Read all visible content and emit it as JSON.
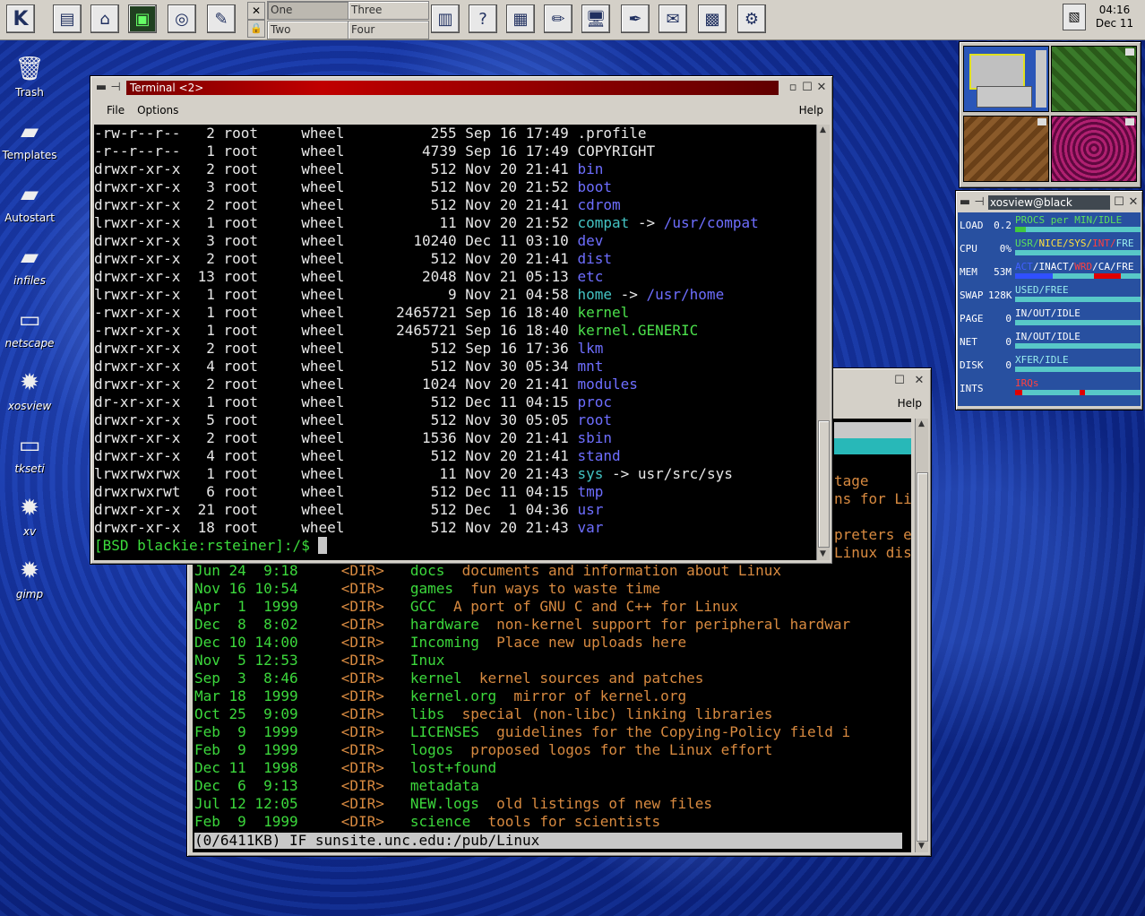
{
  "taskbar": {
    "pager": [
      "One",
      "Three",
      "Two",
      "Four"
    ],
    "clock_time": "04:16",
    "clock_date": "Dec 11"
  },
  "desktop_icons": [
    {
      "label": "Trash",
      "icon": "trash-icon"
    },
    {
      "label": "Templates",
      "icon": "folder-icon"
    },
    {
      "label": "Autostart",
      "icon": "folder-icon"
    },
    {
      "label": "infiles",
      "icon": "folder-icon"
    },
    {
      "label": "netscape",
      "icon": "monitor-icon"
    },
    {
      "label": "xosview",
      "icon": "gear-icon"
    },
    {
      "label": "tkseti",
      "icon": "monitor-icon"
    },
    {
      "label": "xv",
      "icon": "gear-icon"
    },
    {
      "label": "gimp",
      "icon": "gear-icon"
    }
  ],
  "terminal": {
    "title": "Terminal <2>",
    "menu": {
      "file": "File",
      "options": "Options",
      "help": "Help"
    },
    "rows": [
      {
        "perm": "-rw-r--r--",
        "links": "2",
        "owner": "root",
        "group": "wheel",
        "size": "255",
        "mon": "Sep",
        "day": "16",
        "time": "17:49",
        "name": ".profile",
        "color": "white",
        "link": ""
      },
      {
        "perm": "-r--r--r--",
        "links": "1",
        "owner": "root",
        "group": "wheel",
        "size": "4739",
        "mon": "Sep",
        "day": "16",
        "time": "17:49",
        "name": "COPYRIGHT",
        "color": "white",
        "link": ""
      },
      {
        "perm": "drwxr-xr-x",
        "links": "2",
        "owner": "root",
        "group": "wheel",
        "size": "512",
        "mon": "Nov",
        "day": "20",
        "time": "21:41",
        "name": "bin",
        "color": "blue",
        "link": ""
      },
      {
        "perm": "drwxr-xr-x",
        "links": "3",
        "owner": "root",
        "group": "wheel",
        "size": "512",
        "mon": "Nov",
        "day": "20",
        "time": "21:52",
        "name": "boot",
        "color": "blue",
        "link": ""
      },
      {
        "perm": "drwxr-xr-x",
        "links": "2",
        "owner": "root",
        "group": "wheel",
        "size": "512",
        "mon": "Nov",
        "day": "20",
        "time": "21:41",
        "name": "cdrom",
        "color": "blue",
        "link": ""
      },
      {
        "perm": "lrwxr-xr-x",
        "links": "1",
        "owner": "root",
        "group": "wheel",
        "size": "11",
        "mon": "Nov",
        "day": "20",
        "time": "21:52",
        "name": "compat",
        "color": "cyan",
        "link": "/usr/compat"
      },
      {
        "perm": "drwxr-xr-x",
        "links": "3",
        "owner": "root",
        "group": "wheel",
        "size": "10240",
        "mon": "Dec",
        "day": "11",
        "time": "03:10",
        "name": "dev",
        "color": "blue",
        "link": ""
      },
      {
        "perm": "drwxr-xr-x",
        "links": "2",
        "owner": "root",
        "group": "wheel",
        "size": "512",
        "mon": "Nov",
        "day": "20",
        "time": "21:41",
        "name": "dist",
        "color": "blue",
        "link": ""
      },
      {
        "perm": "drwxr-xr-x",
        "links": "13",
        "owner": "root",
        "group": "wheel",
        "size": "2048",
        "mon": "Nov",
        "day": "21",
        "time": "05:13",
        "name": "etc",
        "color": "blue",
        "link": ""
      },
      {
        "perm": "lrwxr-xr-x",
        "links": "1",
        "owner": "root",
        "group": "wheel",
        "size": "9",
        "mon": "Nov",
        "day": "21",
        "time": "04:58",
        "name": "home",
        "color": "cyan",
        "link": "/usr/home"
      },
      {
        "perm": "-rwxr-xr-x",
        "links": "1",
        "owner": "root",
        "group": "wheel",
        "size": "2465721",
        "mon": "Sep",
        "day": "16",
        "time": "18:40",
        "name": "kernel",
        "color": "green",
        "link": ""
      },
      {
        "perm": "-rwxr-xr-x",
        "links": "1",
        "owner": "root",
        "group": "wheel",
        "size": "2465721",
        "mon": "Sep",
        "day": "16",
        "time": "18:40",
        "name": "kernel.GENERIC",
        "color": "green",
        "link": ""
      },
      {
        "perm": "drwxr-xr-x",
        "links": "2",
        "owner": "root",
        "group": "wheel",
        "size": "512",
        "mon": "Sep",
        "day": "16",
        "time": "17:36",
        "name": "lkm",
        "color": "blue",
        "link": ""
      },
      {
        "perm": "drwxr-xr-x",
        "links": "4",
        "owner": "root",
        "group": "wheel",
        "size": "512",
        "mon": "Nov",
        "day": "30",
        "time": "05:34",
        "name": "mnt",
        "color": "blue",
        "link": ""
      },
      {
        "perm": "drwxr-xr-x",
        "links": "2",
        "owner": "root",
        "group": "wheel",
        "size": "1024",
        "mon": "Nov",
        "day": "20",
        "time": "21:41",
        "name": "modules",
        "color": "blue",
        "link": ""
      },
      {
        "perm": "dr-xr-xr-x",
        "links": "1",
        "owner": "root",
        "group": "wheel",
        "size": "512",
        "mon": "Dec",
        "day": "11",
        "time": "04:15",
        "name": "proc",
        "color": "blue",
        "link": ""
      },
      {
        "perm": "drwxr-xr-x",
        "links": "5",
        "owner": "root",
        "group": "wheel",
        "size": "512",
        "mon": "Nov",
        "day": "30",
        "time": "05:05",
        "name": "root",
        "color": "blue",
        "link": ""
      },
      {
        "perm": "drwxr-xr-x",
        "links": "2",
        "owner": "root",
        "group": "wheel",
        "size": "1536",
        "mon": "Nov",
        "day": "20",
        "time": "21:41",
        "name": "sbin",
        "color": "blue",
        "link": ""
      },
      {
        "perm": "drwxr-xr-x",
        "links": "4",
        "owner": "root",
        "group": "wheel",
        "size": "512",
        "mon": "Nov",
        "day": "20",
        "time": "21:41",
        "name": "stand",
        "color": "blue",
        "link": ""
      },
      {
        "perm": "lrwxrwxrwx",
        "links": "1",
        "owner": "root",
        "group": "wheel",
        "size": "11",
        "mon": "Nov",
        "day": "20",
        "time": "21:43",
        "name": "sys",
        "color": "cyan",
        "link": "usr/src/sys"
      },
      {
        "perm": "drwxrwxrwt",
        "links": "6",
        "owner": "root",
        "group": "wheel",
        "size": "512",
        "mon": "Dec",
        "day": "11",
        "time": "04:15",
        "name": "tmp",
        "color": "blue",
        "link": ""
      },
      {
        "perm": "drwxr-xr-x",
        "links": "21",
        "owner": "root",
        "group": "wheel",
        "size": "512",
        "mon": "Dec",
        "day": "1",
        "time": "04:36",
        "name": "usr",
        "color": "blue",
        "link": ""
      },
      {
        "perm": "drwxr-xr-x",
        "links": "18",
        "owner": "root",
        "group": "wheel",
        "size": "512",
        "mon": "Nov",
        "day": "20",
        "time": "21:43",
        "name": "var",
        "color": "blue",
        "link": ""
      }
    ],
    "prompt": "[BSD blackie:rsteiner]:/$ "
  },
  "ftp_window": {
    "help": "Help",
    "partial_lines": [
      "tage",
      "ns for Li",
      "",
      "preters e",
      "Linux dis"
    ],
    "rows": [
      {
        "date": "Jun 24  9:18",
        "type": "<DIR>",
        "name": "docs",
        "desc": "documents and information about Linux"
      },
      {
        "date": "Nov 16 10:54",
        "type": "<DIR>",
        "name": "games",
        "desc": "fun ways to waste time"
      },
      {
        "date": "Apr  1  1999",
        "type": "<DIR>",
        "name": "GCC",
        "desc": "A port of GNU C and C++ for Linux"
      },
      {
        "date": "Dec  8  8:02",
        "type": "<DIR>",
        "name": "hardware",
        "desc": "non-kernel support for peripheral hardwar"
      },
      {
        "date": "Dec 10 14:00",
        "type": "<DIR>",
        "name": "Incoming",
        "desc": "Place new uploads here"
      },
      {
        "date": "Nov  5 12:53",
        "type": "<DIR>",
        "name": "Inux",
        "desc": ""
      },
      {
        "date": "Sep  3  8:46",
        "type": "<DIR>",
        "name": "kernel",
        "desc": "kernel sources and patches"
      },
      {
        "date": "Mar 18  1999",
        "type": "<DIR>",
        "name": "kernel.org",
        "desc": "mirror of kernel.org"
      },
      {
        "date": "Oct 25  9:09",
        "type": "<DIR>",
        "name": "libs",
        "desc": "special (non-libc) linking libraries"
      },
      {
        "date": "Feb  9  1999",
        "type": "<DIR>",
        "name": "LICENSES",
        "desc": "guidelines for the Copying-Policy field i"
      },
      {
        "date": "Feb  9  1999",
        "type": "<DIR>",
        "name": "logos",
        "desc": "proposed logos for the Linux effort"
      },
      {
        "date": "Dec 11  1998",
        "type": "<DIR>",
        "name": "lost+found",
        "desc": ""
      },
      {
        "date": "Dec  6  9:13",
        "type": "<DIR>",
        "name": "metadata",
        "desc": ""
      },
      {
        "date": "Jul 12 12:05",
        "type": "<DIR>",
        "name": "NEW.logs",
        "desc": "old listings of new files"
      },
      {
        "date": "Feb  9  1999",
        "type": "<DIR>",
        "name": "science",
        "desc": "tools for scientists"
      }
    ],
    "status": " (0/6411KB) IF sunsite.unc.edu:/pub/Linux"
  },
  "xosview": {
    "title": "xosview@black",
    "rows": [
      {
        "label": "LOAD",
        "value": "0.2",
        "head": "PROCS per MIN/IDLE"
      },
      {
        "label": "CPU",
        "value": "0%",
        "head": "USR/NICE/SYS/INT/FRE"
      },
      {
        "label": "MEM",
        "value": "53M",
        "head": "ACT/INACT/WRD/CA/FRE"
      },
      {
        "label": "SWAP",
        "value": "128K",
        "head": "USED/FREE"
      },
      {
        "label": "PAGE",
        "value": "0",
        "head": "IN/OUT/IDLE"
      },
      {
        "label": "NET",
        "value": "0",
        "head": "IN/OUT/IDLE"
      },
      {
        "label": "DISK",
        "value": "0",
        "head": "XFER/IDLE"
      },
      {
        "label": "INTS",
        "value": "",
        "head": "IRQs"
      }
    ]
  },
  "colors": {
    "title_active": "#c00000",
    "desktop": "#1a3aa8",
    "terminal_bg": "#000000",
    "dir_blue": "#6e6eff",
    "link_cyan": "#44c4c4",
    "exec_green": "#4ce04c"
  }
}
